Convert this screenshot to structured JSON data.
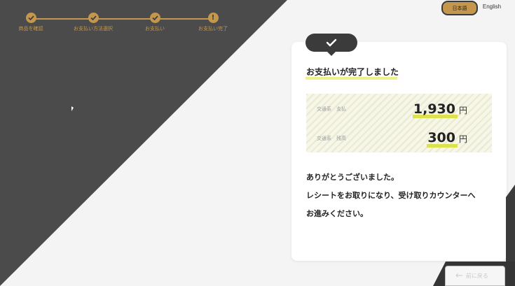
{
  "stepper": {
    "steps": [
      {
        "label": "商品を確認",
        "icon": "check"
      },
      {
        "label": "お支払い方法選択",
        "icon": "check"
      },
      {
        "label": "お支払い",
        "icon": "check"
      },
      {
        "label": "お支払い完了",
        "icon": "exclamation"
      }
    ],
    "accent": "#c4974c"
  },
  "language": {
    "japanese": "日本語",
    "english": "English"
  },
  "card": {
    "title": "お支払いが完了しました",
    "payment": {
      "label": "交通系　支払",
      "value": "1,930",
      "unit": "円"
    },
    "balance": {
      "label": "交通系　残高",
      "value": "300",
      "unit": "円"
    },
    "messages": [
      "ありがとうございました。",
      "レシートをお取りになり、受け取りカウンターへ",
      "お進みください。"
    ]
  },
  "back_button": {
    "label": "前に戻る"
  },
  "colors": {
    "dark": "#4c4b4b",
    "highlight": "#dde14b",
    "background": "#f4f4f4"
  }
}
